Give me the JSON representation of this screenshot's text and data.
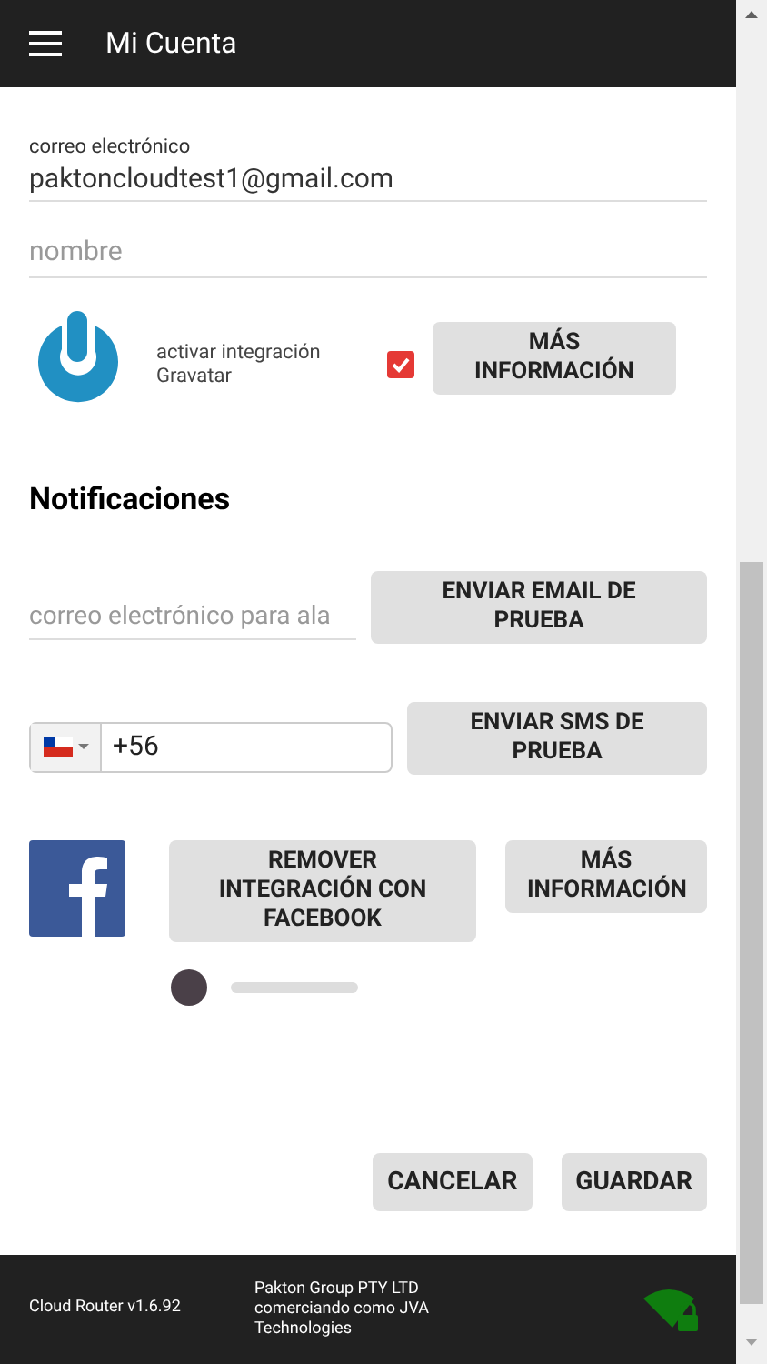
{
  "header": {
    "title": "Mi Cuenta"
  },
  "account": {
    "email_label": "correo electrónico",
    "email_value": "paktoncloudtest1@gmail.com",
    "name_placeholder": "nombre",
    "gravatar_label": "activar integración Gravatar",
    "gravatar_checked": true,
    "more_info": "MÁS INFORMACIÓN"
  },
  "notifications": {
    "heading": "Notificaciones",
    "alert_email_placeholder": "correo electrónico para ala",
    "send_email": "ENVIAR EMAIL DE PRUEBA",
    "phone_value": "+56",
    "send_sms": "ENVIAR SMS DE PRUEBA",
    "remove_facebook": "REMOVER INTEGRACIÓN CON FACEBOOK",
    "facebook_more_info": "MÁS INFORMACIÓN"
  },
  "actions": [
    "CANCELAR",
    "GUARDAR"
  ],
  "footer": {
    "version": "Cloud Router v1.6.92",
    "company": "Pakton Group PTY LTD comerciando como JVA Technologies"
  }
}
